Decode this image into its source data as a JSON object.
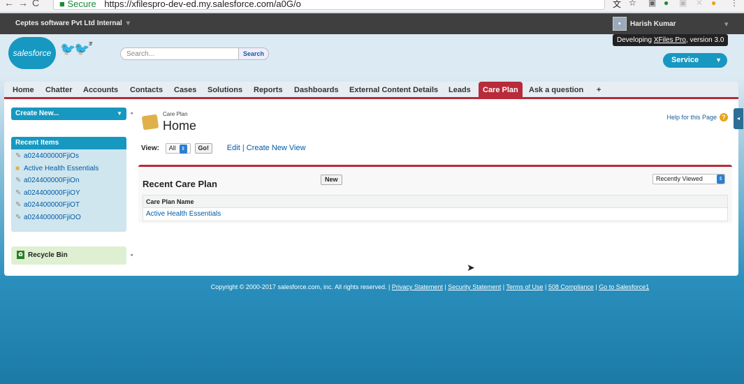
{
  "browser": {
    "secure": "Secure",
    "url": "https://xfilespro-dev-ed.my.salesforce.com/a0G/o"
  },
  "topbar": {
    "org": "Ceptes software Pvt Ltd Internal",
    "user": "Harish Kumar"
  },
  "tooltip": {
    "prefix": "Developing ",
    "app": "XFiles Pro",
    "suffix": ", version 3.0"
  },
  "header": {
    "logo": "salesforce",
    "birds_num": "37",
    "search_placeholder": "Search...",
    "search_btn": "Search",
    "app_menu": "Service"
  },
  "tabs": [
    "Home",
    "Chatter",
    "Accounts",
    "Contacts",
    "Cases",
    "Solutions",
    "Reports",
    "Dashboards",
    "External Content Details",
    "Leads",
    "Care Plan",
    "Ask a question",
    "+"
  ],
  "sidebar": {
    "create_new": "Create New...",
    "recent_title": "Recent Items",
    "recent": [
      "a024400000FjiOs",
      "Active Health Essentials",
      "a024400000FjiOn",
      "a024400000FjiOY",
      "a024400000FjiOT",
      "a024400000FjiOO"
    ],
    "recycle": "Recycle Bin"
  },
  "main": {
    "breadcrumb": "Care Plan",
    "title": "Home",
    "help": "Help for this Page",
    "view_label": "View:",
    "view_value": "All",
    "go": "Go!",
    "edit": "Edit",
    "sep": " | ",
    "create_view": "Create New View",
    "panel_title": "Recent Care Plan",
    "new_btn": "New",
    "recent_select": "Recently Viewed",
    "col_header": "Care Plan Name",
    "row_value": "Active Health Essentials"
  },
  "footer": {
    "copyright": "Copyright © 2000-2017 salesforce.com, inc. All rights reserved.",
    "links": [
      "Privacy Statement",
      "Security Statement",
      "Terms of Use",
      "508 Compliance",
      "Go to Salesforce1"
    ]
  },
  "colors": {
    "brand": "#1798c1",
    "active_tab": "#b82b3a"
  }
}
